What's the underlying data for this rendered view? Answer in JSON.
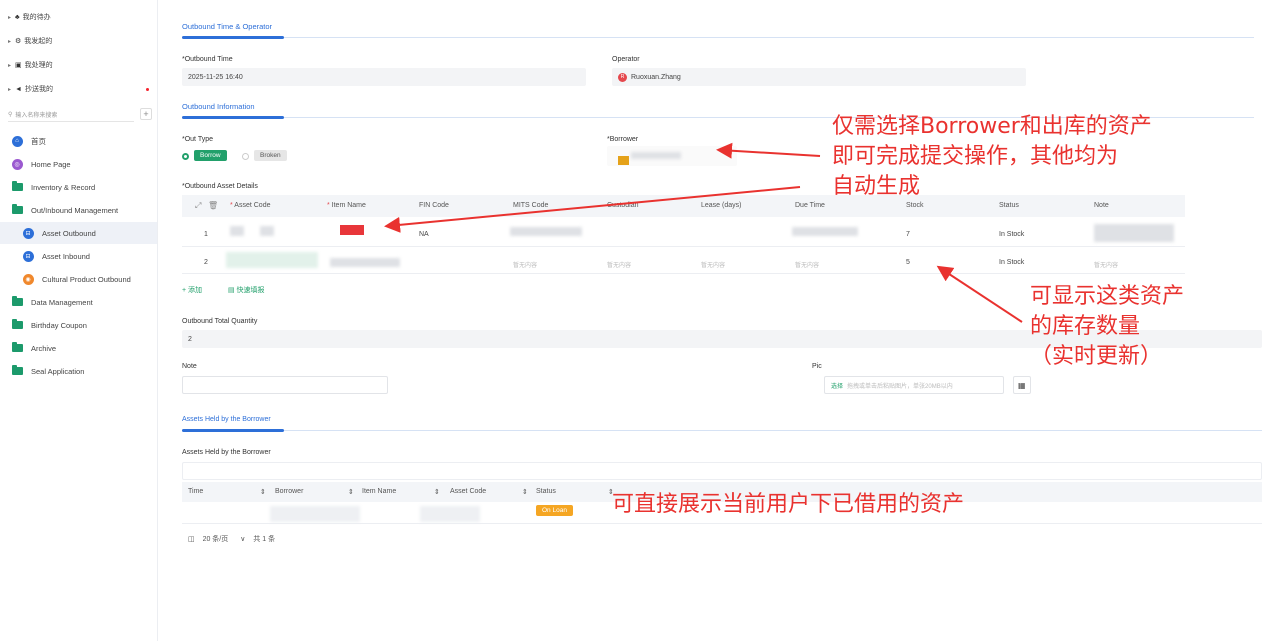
{
  "sidebar": {
    "top_items": [
      {
        "icon": "bell-icon",
        "glyph": "♣",
        "label": "我的待办"
      },
      {
        "icon": "gear-icon",
        "glyph": "⚙",
        "label": "我发起的"
      },
      {
        "icon": "briefcase-icon",
        "glyph": "▣",
        "label": "我处理的"
      },
      {
        "icon": "send-icon",
        "glyph": "◄",
        "label": "抄送我的"
      }
    ],
    "search_placeholder": "输入名称来搜索",
    "plus": "+",
    "nav": [
      {
        "label": "首页",
        "icon": "home-icon"
      },
      {
        "label": "Home Page",
        "icon": "home-page-icon"
      },
      {
        "label": "Inventory & Record",
        "icon": "folder-icon"
      },
      {
        "label": "Out/Inbound Management",
        "icon": "folder-icon"
      },
      {
        "label": "Asset Outbound",
        "icon": "outbound-icon"
      },
      {
        "label": "Asset Inbound",
        "icon": "inbound-icon"
      },
      {
        "label": "Cultural Product Outbound",
        "icon": "cultural-icon"
      },
      {
        "label": "Data Management",
        "icon": "folder-icon"
      },
      {
        "label": "Birthday Coupon",
        "icon": "folder-icon"
      },
      {
        "label": "Archive",
        "icon": "folder-icon"
      },
      {
        "label": "Seal Application",
        "icon": "folder-icon"
      }
    ]
  },
  "section1": {
    "title": "Outbound Time & Operator",
    "time_label": "*Outbound Time",
    "time_value": "2025-11-25 16:40",
    "operator_label": "Operator",
    "operator_initial": "R",
    "operator_value": "Ruoxuan.Zhang"
  },
  "section2": {
    "title": "Outbound Information",
    "out_type_label": "*Out Type",
    "borrow": "Borrow",
    "broken": "Broken",
    "borrower_label": "*Borrower",
    "details_label": "*Outbound Asset Details",
    "columns": [
      "Asset Code",
      "Item Name",
      "FIN Code",
      "MITS Code",
      "Custodian",
      "Lease (days)",
      "Due Time",
      "Stock",
      "Status",
      "Note"
    ],
    "rows": [
      {
        "no": "1",
        "fin": "NA",
        "stock": "7",
        "status": "In Stock"
      },
      {
        "no": "2",
        "placeholder": "暂无内容",
        "stock": "5",
        "status": "In Stock"
      }
    ],
    "add": "+ 添加",
    "quick_add": "▤ 快速填报",
    "total_label": "Outbound Total Quantity",
    "total_value": "2",
    "note_label": "Note",
    "pic_label": "Pic",
    "pic_select": "选择",
    "pic_hint": "拖拽或单击后粘贴图片，单张20MB以内"
  },
  "section3": {
    "title": "Assets Held by the Borrower",
    "sub_label": "Assets Held by the Borrower",
    "columns": [
      "Time",
      "Borrower",
      "Item Name",
      "Asset Code",
      "Status"
    ],
    "status_value": "On Loan",
    "pager_size": "20 条/页",
    "pager_total": "共 1 条"
  },
  "annotations": {
    "a1": [
      "仅需选择Borrower和出库的资产",
      "即可完成提交操作，其他均为",
      "自动生成"
    ],
    "a2": [
      "可显示这类资产",
      "的库存数量",
      "（实时更新）"
    ],
    "a3": "可直接展示当前用户下已借用的资产"
  },
  "colors": {
    "accent": "#2d6fd8",
    "annotation": "#e9322f",
    "status_orange": "#f5a623",
    "borrow_green": "#22a06b"
  }
}
